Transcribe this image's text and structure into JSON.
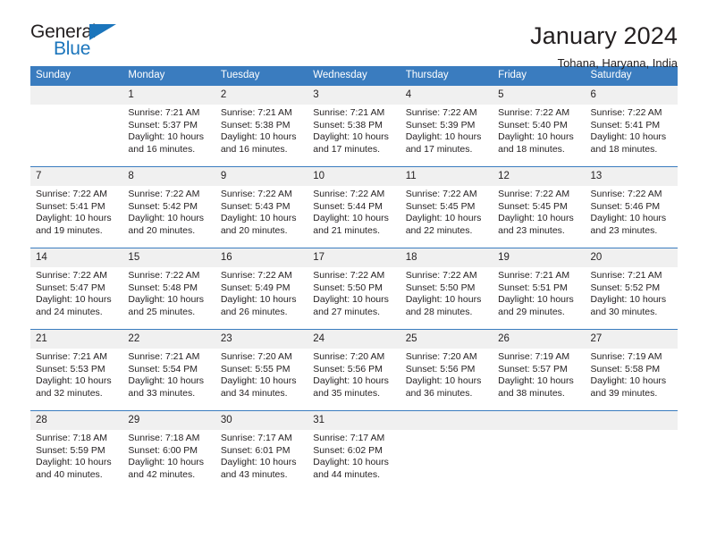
{
  "brand": {
    "name_part1": "General",
    "name_part2": "Blue",
    "logo_icon": "blue-triangle"
  },
  "header": {
    "title": "January 2024",
    "subtitle": "Tohana, Haryana, India"
  },
  "calendar": {
    "weekday_headers": [
      "Sunday",
      "Monday",
      "Tuesday",
      "Wednesday",
      "Thursday",
      "Friday",
      "Saturday"
    ],
    "accent_color": "#3a7cbf",
    "daynum_band_color": "#f0f0f0",
    "weeks": [
      [
        {
          "day": "",
          "empty": true
        },
        {
          "day": "1",
          "sunrise": "Sunrise: 7:21 AM",
          "sunset": "Sunset: 5:37 PM",
          "daylight_line1": "Daylight: 10 hours",
          "daylight_line2": "and 16 minutes."
        },
        {
          "day": "2",
          "sunrise": "Sunrise: 7:21 AM",
          "sunset": "Sunset: 5:38 PM",
          "daylight_line1": "Daylight: 10 hours",
          "daylight_line2": "and 16 minutes."
        },
        {
          "day": "3",
          "sunrise": "Sunrise: 7:21 AM",
          "sunset": "Sunset: 5:38 PM",
          "daylight_line1": "Daylight: 10 hours",
          "daylight_line2": "and 17 minutes."
        },
        {
          "day": "4",
          "sunrise": "Sunrise: 7:22 AM",
          "sunset": "Sunset: 5:39 PM",
          "daylight_line1": "Daylight: 10 hours",
          "daylight_line2": "and 17 minutes."
        },
        {
          "day": "5",
          "sunrise": "Sunrise: 7:22 AM",
          "sunset": "Sunset: 5:40 PM",
          "daylight_line1": "Daylight: 10 hours",
          "daylight_line2": "and 18 minutes."
        },
        {
          "day": "6",
          "sunrise": "Sunrise: 7:22 AM",
          "sunset": "Sunset: 5:41 PM",
          "daylight_line1": "Daylight: 10 hours",
          "daylight_line2": "and 18 minutes."
        }
      ],
      [
        {
          "day": "7",
          "sunrise": "Sunrise: 7:22 AM",
          "sunset": "Sunset: 5:41 PM",
          "daylight_line1": "Daylight: 10 hours",
          "daylight_line2": "and 19 minutes."
        },
        {
          "day": "8",
          "sunrise": "Sunrise: 7:22 AM",
          "sunset": "Sunset: 5:42 PM",
          "daylight_line1": "Daylight: 10 hours",
          "daylight_line2": "and 20 minutes."
        },
        {
          "day": "9",
          "sunrise": "Sunrise: 7:22 AM",
          "sunset": "Sunset: 5:43 PM",
          "daylight_line1": "Daylight: 10 hours",
          "daylight_line2": "and 20 minutes."
        },
        {
          "day": "10",
          "sunrise": "Sunrise: 7:22 AM",
          "sunset": "Sunset: 5:44 PM",
          "daylight_line1": "Daylight: 10 hours",
          "daylight_line2": "and 21 minutes."
        },
        {
          "day": "11",
          "sunrise": "Sunrise: 7:22 AM",
          "sunset": "Sunset: 5:45 PM",
          "daylight_line1": "Daylight: 10 hours",
          "daylight_line2": "and 22 minutes."
        },
        {
          "day": "12",
          "sunrise": "Sunrise: 7:22 AM",
          "sunset": "Sunset: 5:45 PM",
          "daylight_line1": "Daylight: 10 hours",
          "daylight_line2": "and 23 minutes."
        },
        {
          "day": "13",
          "sunrise": "Sunrise: 7:22 AM",
          "sunset": "Sunset: 5:46 PM",
          "daylight_line1": "Daylight: 10 hours",
          "daylight_line2": "and 23 minutes."
        }
      ],
      [
        {
          "day": "14",
          "sunrise": "Sunrise: 7:22 AM",
          "sunset": "Sunset: 5:47 PM",
          "daylight_line1": "Daylight: 10 hours",
          "daylight_line2": "and 24 minutes."
        },
        {
          "day": "15",
          "sunrise": "Sunrise: 7:22 AM",
          "sunset": "Sunset: 5:48 PM",
          "daylight_line1": "Daylight: 10 hours",
          "daylight_line2": "and 25 minutes."
        },
        {
          "day": "16",
          "sunrise": "Sunrise: 7:22 AM",
          "sunset": "Sunset: 5:49 PM",
          "daylight_line1": "Daylight: 10 hours",
          "daylight_line2": "and 26 minutes."
        },
        {
          "day": "17",
          "sunrise": "Sunrise: 7:22 AM",
          "sunset": "Sunset: 5:50 PM",
          "daylight_line1": "Daylight: 10 hours",
          "daylight_line2": "and 27 minutes."
        },
        {
          "day": "18",
          "sunrise": "Sunrise: 7:22 AM",
          "sunset": "Sunset: 5:50 PM",
          "daylight_line1": "Daylight: 10 hours",
          "daylight_line2": "and 28 minutes."
        },
        {
          "day": "19",
          "sunrise": "Sunrise: 7:21 AM",
          "sunset": "Sunset: 5:51 PM",
          "daylight_line1": "Daylight: 10 hours",
          "daylight_line2": "and 29 minutes."
        },
        {
          "day": "20",
          "sunrise": "Sunrise: 7:21 AM",
          "sunset": "Sunset: 5:52 PM",
          "daylight_line1": "Daylight: 10 hours",
          "daylight_line2": "and 30 minutes."
        }
      ],
      [
        {
          "day": "21",
          "sunrise": "Sunrise: 7:21 AM",
          "sunset": "Sunset: 5:53 PM",
          "daylight_line1": "Daylight: 10 hours",
          "daylight_line2": "and 32 minutes."
        },
        {
          "day": "22",
          "sunrise": "Sunrise: 7:21 AM",
          "sunset": "Sunset: 5:54 PM",
          "daylight_line1": "Daylight: 10 hours",
          "daylight_line2": "and 33 minutes."
        },
        {
          "day": "23",
          "sunrise": "Sunrise: 7:20 AM",
          "sunset": "Sunset: 5:55 PM",
          "daylight_line1": "Daylight: 10 hours",
          "daylight_line2": "and 34 minutes."
        },
        {
          "day": "24",
          "sunrise": "Sunrise: 7:20 AM",
          "sunset": "Sunset: 5:56 PM",
          "daylight_line1": "Daylight: 10 hours",
          "daylight_line2": "and 35 minutes."
        },
        {
          "day": "25",
          "sunrise": "Sunrise: 7:20 AM",
          "sunset": "Sunset: 5:56 PM",
          "daylight_line1": "Daylight: 10 hours",
          "daylight_line2": "and 36 minutes."
        },
        {
          "day": "26",
          "sunrise": "Sunrise: 7:19 AM",
          "sunset": "Sunset: 5:57 PM",
          "daylight_line1": "Daylight: 10 hours",
          "daylight_line2": "and 38 minutes."
        },
        {
          "day": "27",
          "sunrise": "Sunrise: 7:19 AM",
          "sunset": "Sunset: 5:58 PM",
          "daylight_line1": "Daylight: 10 hours",
          "daylight_line2": "and 39 minutes."
        }
      ],
      [
        {
          "day": "28",
          "sunrise": "Sunrise: 7:18 AM",
          "sunset": "Sunset: 5:59 PM",
          "daylight_line1": "Daylight: 10 hours",
          "daylight_line2": "and 40 minutes."
        },
        {
          "day": "29",
          "sunrise": "Sunrise: 7:18 AM",
          "sunset": "Sunset: 6:00 PM",
          "daylight_line1": "Daylight: 10 hours",
          "daylight_line2": "and 42 minutes."
        },
        {
          "day": "30",
          "sunrise": "Sunrise: 7:17 AM",
          "sunset": "Sunset: 6:01 PM",
          "daylight_line1": "Daylight: 10 hours",
          "daylight_line2": "and 43 minutes."
        },
        {
          "day": "31",
          "sunrise": "Sunrise: 7:17 AM",
          "sunset": "Sunset: 6:02 PM",
          "daylight_line1": "Daylight: 10 hours",
          "daylight_line2": "and 44 minutes."
        },
        {
          "day": "",
          "empty": true
        },
        {
          "day": "",
          "empty": true
        },
        {
          "day": "",
          "empty": true
        }
      ]
    ]
  }
}
